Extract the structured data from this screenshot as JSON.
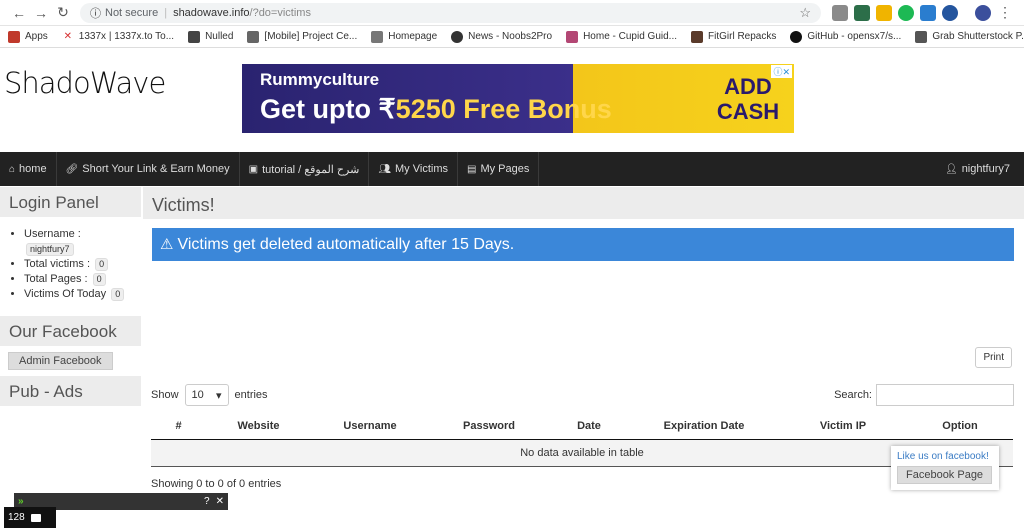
{
  "browser": {
    "security": "Not secure",
    "url_host": "shadowave.info",
    "url_path": "/?do=victims"
  },
  "bookmarks": [
    {
      "label": "Apps",
      "color": "#c0392b"
    },
    {
      "label": "1337x | 1337x.to To...",
      "color": "#d63031"
    },
    {
      "label": "Nulled",
      "color": "#444444"
    },
    {
      "label": "[Mobile] Project Ce...",
      "color": "#666666"
    },
    {
      "label": "Homepage",
      "color": "#777777"
    },
    {
      "label": "News - Noobs2Pro",
      "color": "#333333"
    },
    {
      "label": "Home - Cupid Guid...",
      "color": "#b34774"
    },
    {
      "label": "FitGirl Repacks",
      "color": "#5a3a2a"
    },
    {
      "label": "GitHub - opensx7/s...",
      "color": "#111111"
    },
    {
      "label": "Grab Shutterstock P...",
      "color": "#555555"
    }
  ],
  "site": {
    "logo": "ShadoWave",
    "ad": {
      "brand": "Rummyculture",
      "text_a": "Get upto ₹",
      "text_b": "5250 Free Bonus",
      "cta_1": "ADD",
      "cta_2": "CASH"
    },
    "nav": {
      "home": "home",
      "short": "Short Your Link & Earn Money",
      "tutorial": "tutorial / شرح الموقع",
      "victims": "My Victims",
      "pages": "My Pages",
      "user": "nightfury7"
    }
  },
  "sidebar": {
    "login_title": "Login Panel",
    "username_label": "Username :",
    "username_value": "nightfury7",
    "total_victims_label": "Total victims :",
    "total_victims": "0",
    "total_pages_label": "Total Pages :",
    "total_pages": "0",
    "victims_today_label": "Victims Of Today",
    "victims_today": "0",
    "facebook_title": "Our Facebook",
    "admin_facebook": "Admin Facebook",
    "pub_title": "Pub - Ads"
  },
  "main": {
    "title": "Victims!",
    "alert": "Victims get deleted automatically after 15 Days.",
    "print": "Print",
    "show_label": "Show",
    "entries_value": "10",
    "entries_label": "entries",
    "search_label": "Search:",
    "columns": [
      "#",
      "Website",
      "Username",
      "Password",
      "Date",
      "Expiration Date",
      "Victim IP",
      "Option"
    ],
    "empty": "No data available in table",
    "showing": "Showing 0 to 0 of 0 entries"
  },
  "fb_widget": {
    "title": "Like us on facebook!",
    "button": "Facebook Page"
  },
  "bottom": {
    "question": "?",
    "close": "✕",
    "count": "128"
  }
}
